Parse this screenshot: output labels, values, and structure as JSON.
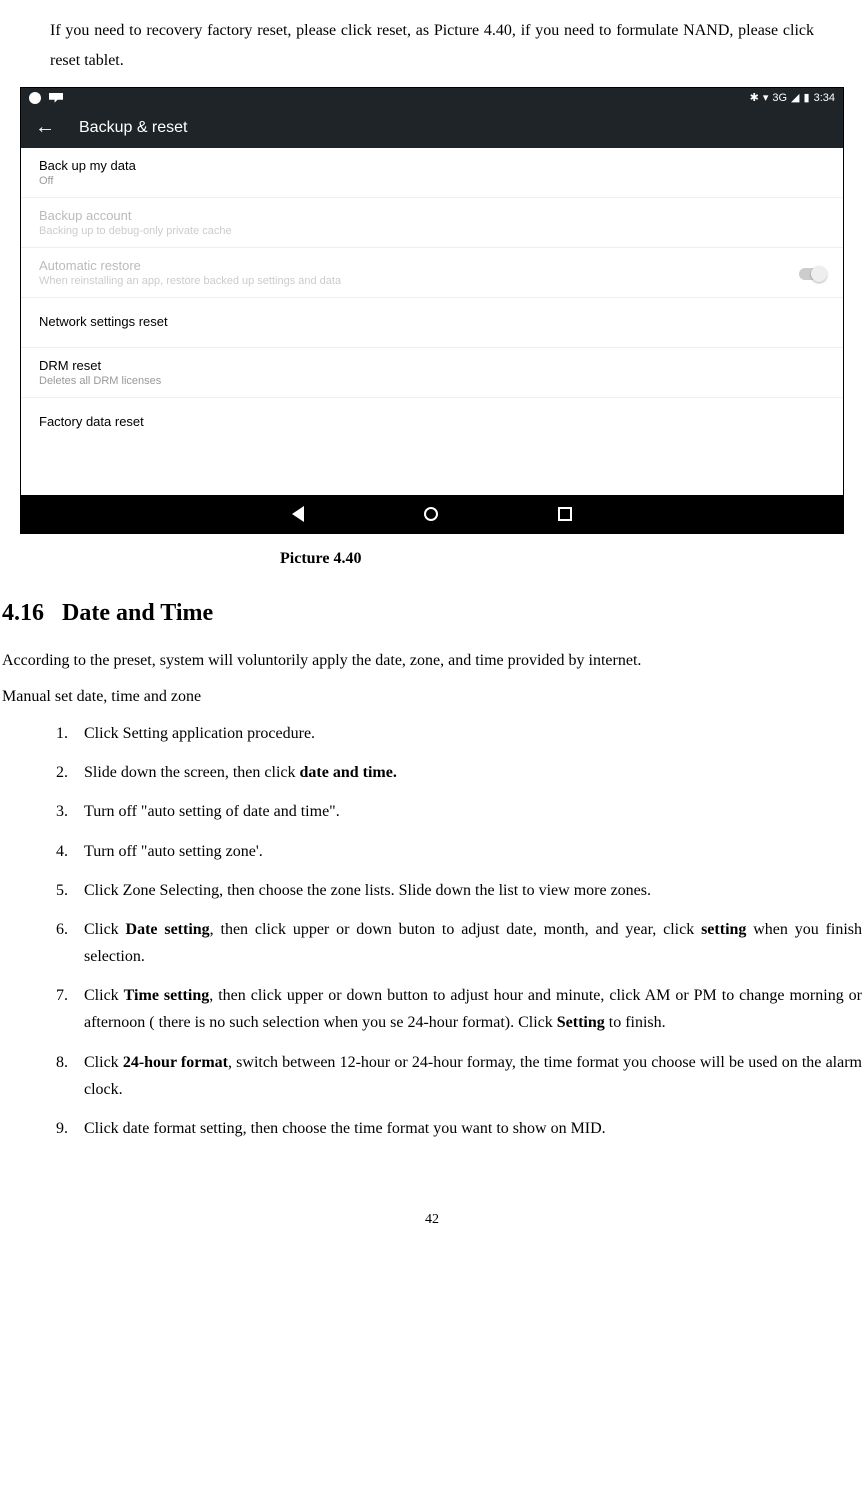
{
  "intro": "If you need to recovery factory reset, please click reset, as Picture 4.40, if you need to formulate NAND, please click reset tablet.",
  "status": {
    "time": "3:34",
    "signal": "3G"
  },
  "header": {
    "title": "Backup & reset"
  },
  "settings": {
    "backup_data": {
      "title": "Back up my data",
      "sub": "Off"
    },
    "backup_account": {
      "title": "Backup account",
      "sub": "Backing up to debug-only private cache"
    },
    "auto_restore": {
      "title": "Automatic restore",
      "sub": "When reinstalling an app, restore backed up settings and data"
    },
    "network_reset": {
      "title": "Network settings reset"
    },
    "drm_reset": {
      "title": "DRM reset",
      "sub": "Deletes all DRM licenses"
    },
    "factory_reset": {
      "title": "Factory data reset"
    }
  },
  "caption": "Picture 4.40",
  "section_number": "4.16",
  "section_title": "Date and Time",
  "paragraph1": "According to the preset, system will voluntorily apply the date, zone, and time provided by internet.",
  "sub_heading": "Manual set date, time and zone",
  "steps": {
    "n1": "1.",
    "t1": "Click Setting application procedure.",
    "n2": "2.",
    "t2a": "Slide down the screen, then click ",
    "t2b": "date and time.",
    "n3": "3.",
    "t3": "Turn off \"auto setting of date and time\".",
    "n4": "4.",
    "t4": "Turn off \"auto setting zone'.",
    "n5": "5.",
    "t5": "Click Zone Selecting, then choose the zone lists. Slide down the list to view more zones.",
    "n6": "6.",
    "t6a": "Click ",
    "t6b": "Date setting",
    "t6c": ", then click upper or down buton to adjust date, month, and year, click ",
    "t6d": "setting",
    "t6e": " when you finish selection.",
    "n7": "7.",
    "t7a": "Click ",
    "t7b": "Time setting",
    "t7c": ", then click upper or down button to adjust hour and minute, click AM or PM to change morning or afternoon ( there is no such selection when you se 24-hour format). Click ",
    "t7d": "Setting",
    "t7e": " to finish.",
    "n8": "8.",
    "t8a": "Click ",
    "t8b": "24-hour format",
    "t8c": ", switch between 12-hour or 24-hour formay, the time format you choose will be used on the alarm clock.",
    "n9": "9.",
    "t9": "Click date format setting, then choose the time format you want to show on MID."
  },
  "page_number": "42"
}
